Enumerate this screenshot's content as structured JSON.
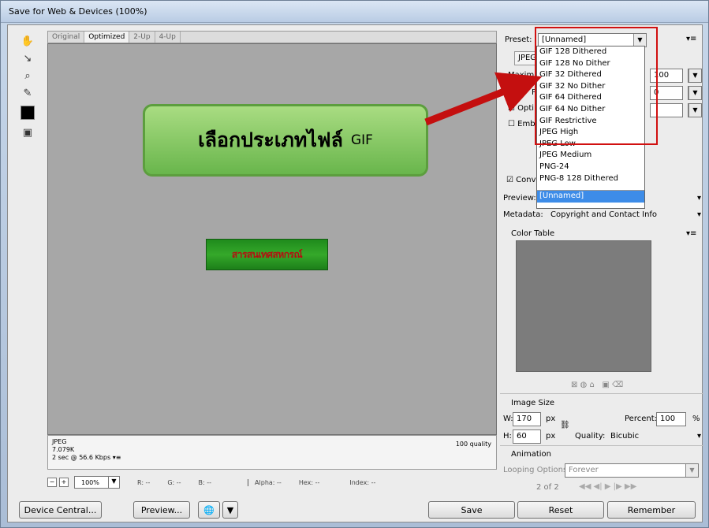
{
  "window": {
    "title": "Save for Web & Devices (100%)"
  },
  "tabs": [
    "Original",
    "Optimized",
    "2-Up",
    "4-Up"
  ],
  "callout": {
    "thai": "เลือกประเภทไฟล์",
    "en": "GIF"
  },
  "banner": "สารสนเทศสหกรณ์",
  "status": {
    "format": "JPEG",
    "size": "7.079K",
    "time": "2 sec @ 56.6 Kbps",
    "menu": "▾≡",
    "quality": "100 quality"
  },
  "bottombar": {
    "zoom": "100%",
    "r": "R: --",
    "g": "G: --",
    "b": "B: --",
    "alpha": "Alpha: --",
    "hex": "Hex: --",
    "index": "Index: --"
  },
  "buttons": {
    "device_central": "Device Central...",
    "preview": "Preview...",
    "save": "Save",
    "reset": "Reset",
    "remember": "Remember"
  },
  "right": {
    "preset_label": "Preset:",
    "preset_value": "[Unnamed]",
    "format_tab": "JPEG",
    "max_label": "Maximun",
    "max_value": "100",
    "prog_label": "Progre",
    "prog_value": "0",
    "optim_label": "Optim",
    "embed_label": "Embed",
    "convert_label": "Conve",
    "preview_label": "Preview:",
    "metadata_label": "Metadata:",
    "metadata_value": "Copyright and Contact Info",
    "color_table": "Color Table",
    "image_size": "Image Size",
    "w_label": "W:",
    "w_value": "170",
    "h_label": "H:",
    "h_value": "60",
    "px": "px",
    "percent_label": "Percent:",
    "percent_value": "100",
    "percent_sign": "%",
    "quality_label": "Quality:",
    "quality_value": "Bicubic",
    "animation": "Animation",
    "looping_label": "Looping Options:",
    "looping_value": "Forever",
    "frame": "2 of 2"
  },
  "preset_options": [
    "GIF 128 Dithered",
    "GIF 128 No Dither",
    "GIF 32 Dithered",
    "GIF 32 No Dither",
    "GIF 64 Dithered",
    "GIF 64 No Dither",
    "GIF Restrictive",
    "JPEG High",
    "JPEG Low",
    "JPEG Medium",
    "PNG-24",
    "PNG-8 128 Dithered",
    "",
    "[Unnamed]"
  ],
  "colors": {
    "accent": "#d11010",
    "callout": "#69b64c",
    "selection": "#3d8ce8"
  }
}
